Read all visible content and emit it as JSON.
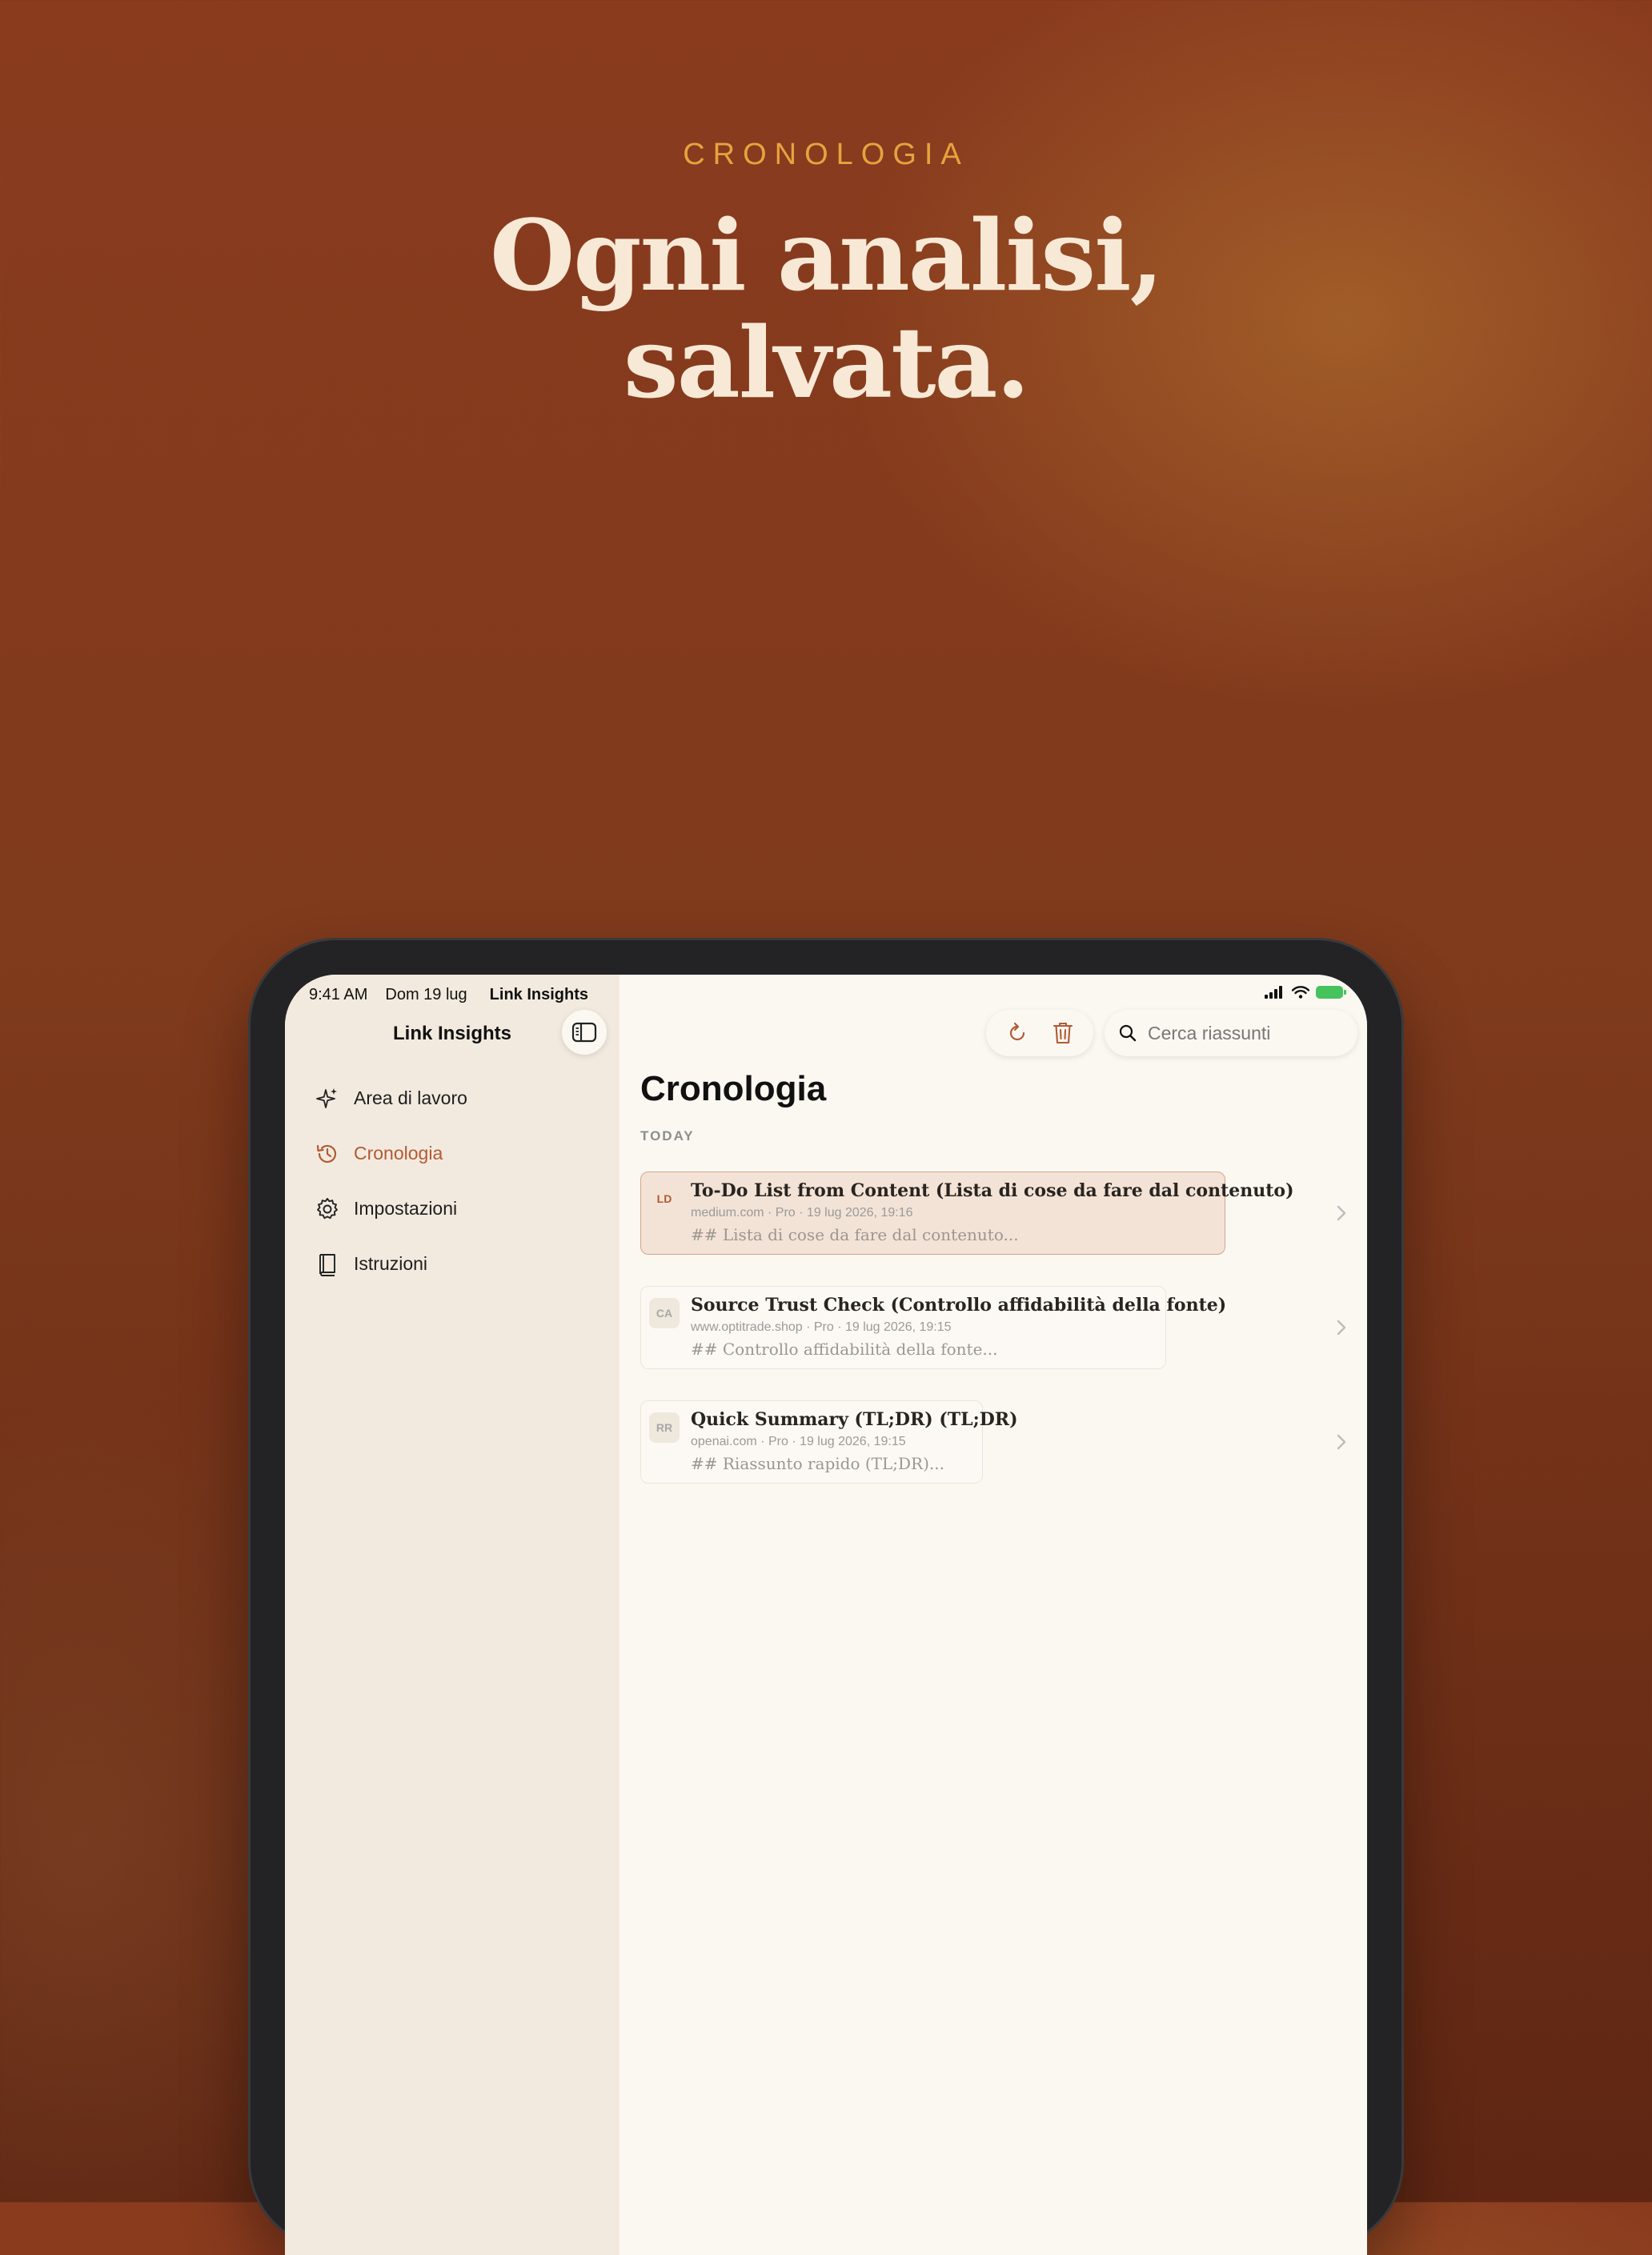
{
  "hero": {
    "eyebrow": "CRONOLOGIA",
    "headline_line1": "Ogni analisi,",
    "headline_line2": "salvata."
  },
  "status_bar": {
    "time": "9:41 AM",
    "date": "Dom 19 lug",
    "app_name": "Link Insights"
  },
  "sidebar": {
    "title": "Link Insights",
    "items": [
      {
        "label": "Area di lavoro",
        "icon": "sparkles-icon",
        "active": false
      },
      {
        "label": "Cronologia",
        "icon": "history-icon",
        "active": true
      },
      {
        "label": "Impostazioni",
        "icon": "gear-icon",
        "active": false
      },
      {
        "label": "Istruzioni",
        "icon": "book-icon",
        "active": false
      }
    ]
  },
  "toolbar": {
    "search_placeholder": "Cerca riassunti"
  },
  "main": {
    "title": "Cronologia",
    "section": "TODAY",
    "items": [
      {
        "badge": "LD",
        "title": "To-Do List from Content (Lista di cose da fare dal contenuto)",
        "meta": "medium.com · Pro · 19 lug 2026, 19:16",
        "preview": "## Lista di cose da fare dal contenuto..."
      },
      {
        "badge": "CA",
        "title": "Source Trust Check (Controllo affidabilità della fonte)",
        "meta": "www.optitrade.shop · Pro · 19 lug 2026, 19:15",
        "preview": "## Controllo affidabilità della fonte..."
      },
      {
        "badge": "RR",
        "title": "Quick Summary (TL;DR) (TL;DR)",
        "meta": "openai.com · Pro · 19 lug 2026, 19:15",
        "preview": "## Riassunto rapido (TL;DR)..."
      }
    ]
  },
  "colors": {
    "accent": "#b25a35",
    "eyebrow": "#e8a23e",
    "headline": "#f7e9d6",
    "sidebar_bg": "#f2eade",
    "main_bg": "#fbf8f2"
  }
}
